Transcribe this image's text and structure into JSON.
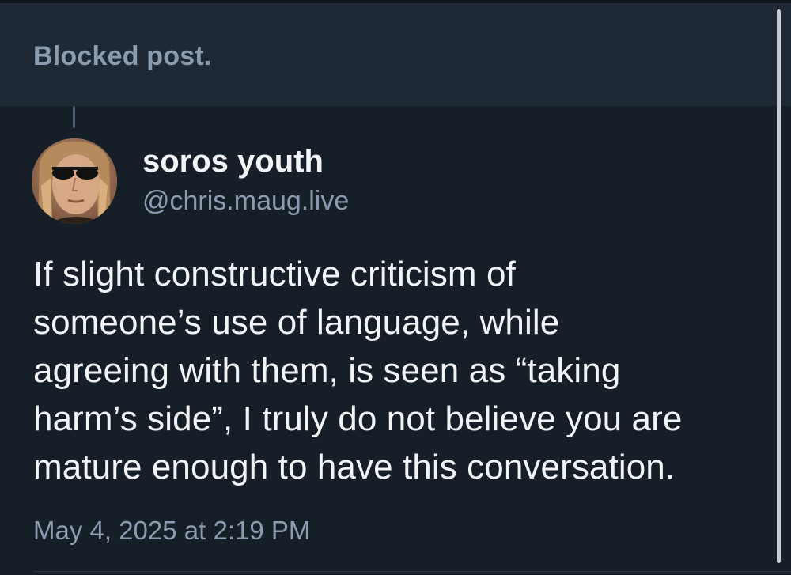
{
  "blocked_post": {
    "label": "Blocked post."
  },
  "post": {
    "author": {
      "display_name": "soros youth",
      "handle": "@chris.maug.live",
      "avatar_icon": "user-avatar-photo"
    },
    "text_lines": [
      "If slight constructive criticism of",
      "someone’s use of language, while",
      "agreeing with them, is seen as “taking",
      "harm’s side”, I truly do not believe you are",
      "mature enough to have this conversation."
    ],
    "timestamp": "May 4, 2025 at 2:19 PM"
  },
  "colors": {
    "background": "#161e27",
    "blocked_bar": "#1e2935",
    "primary_text": "#f1f3f5",
    "secondary_text": "#8c9cb0"
  }
}
